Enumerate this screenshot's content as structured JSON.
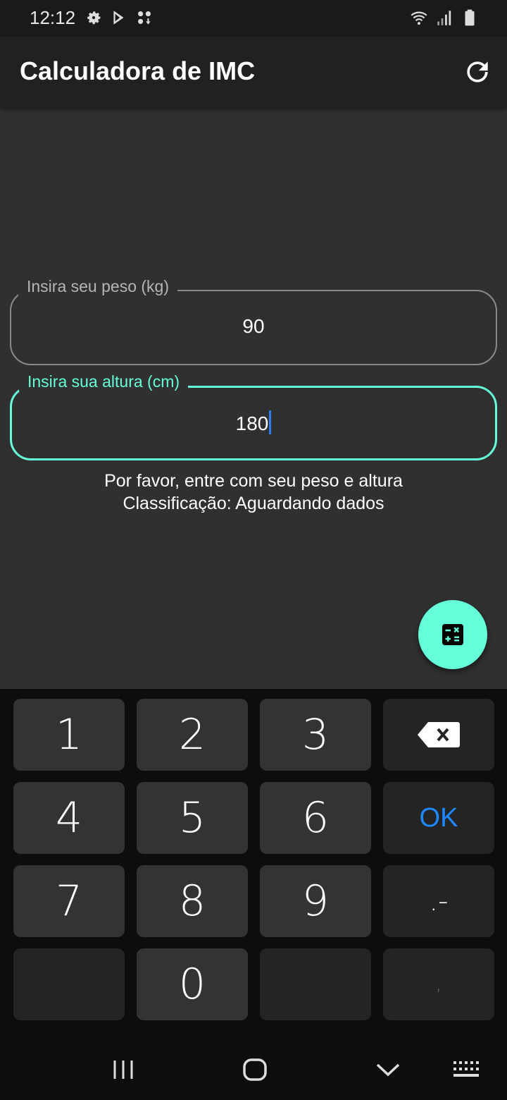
{
  "status_bar": {
    "time": "12:12"
  },
  "app_bar": {
    "title": "Calculadora de IMC"
  },
  "form": {
    "weight": {
      "label": "Insira seu peso (kg)",
      "value": "90"
    },
    "height": {
      "label": "Insira sua altura (cm)",
      "value": "180"
    }
  },
  "info": {
    "message": "Por favor, entre com seu peso e altura",
    "classification": "Classificação:  Aguardando dados"
  },
  "keyboard": {
    "keys": [
      "1",
      "2",
      "3",
      "4",
      "5",
      "6",
      "7",
      "8",
      "9",
      "0"
    ],
    "ok_label": "OK",
    "punct_label": ".-",
    "comma_label": ","
  },
  "colors": {
    "accent": "#64ffda",
    "background": "#303030",
    "appbar": "#212121",
    "ok_key": "#1e88ff"
  }
}
